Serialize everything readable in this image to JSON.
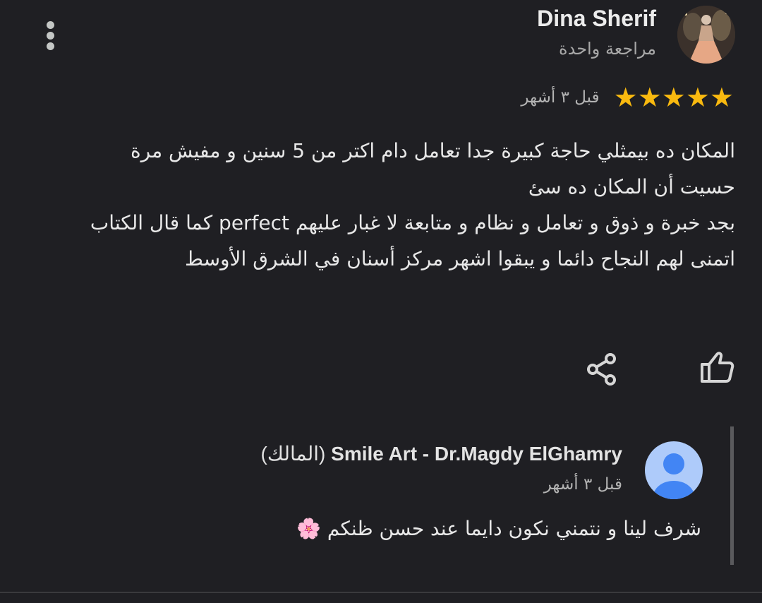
{
  "reviewer": {
    "name": "Dina Sherif",
    "review_count": "مراجعة واحدة"
  },
  "review": {
    "rating": 5,
    "time": "قبل ٣ أشهر",
    "lines": [
      "المكان ده بيمثلي حاجة كبيرة جدا تعامل دام اكتر من 5 سنين و مفيش مرة حسيت أن المكان ده سئ",
      "بجد خبرة و ذوق و تعامل و نظام و متابعة لا غبار عليهم perfect كما قال الكتاب",
      "اتمنى لهم النجاح دائما و يبقوا اشهر مركز أسنان في الشرق الأوسط"
    ]
  },
  "actions": {
    "share_icon": "share-icon",
    "like_icon": "thumb-up-icon"
  },
  "owner_reply": {
    "name": "Smile Art - Dr.Magdy ElGhamry",
    "owner_tag": "(المالك)",
    "time": "قبل ٣ أشهر",
    "text": "شرف لينا و نتمني نكون دايما عند حسن ظنكم 🌸"
  },
  "colors": {
    "background": "#1f1f23",
    "star": "#f9b90f",
    "owner_avatar": "#aecbfa",
    "owner_avatar_figure": "#4285f4"
  }
}
